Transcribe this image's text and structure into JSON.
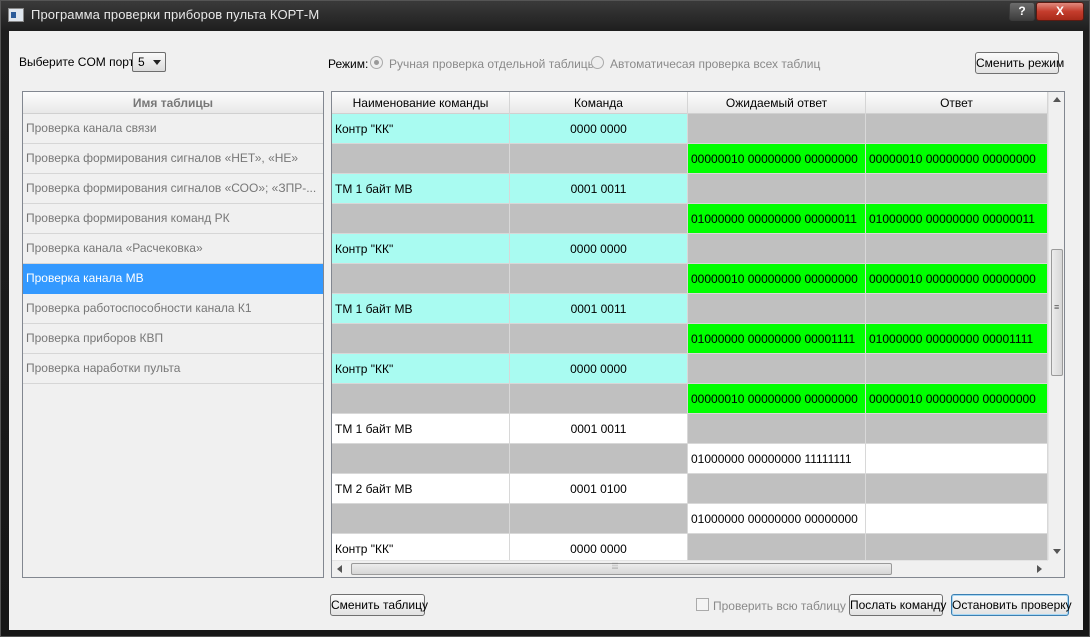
{
  "window": {
    "title": "Программа проверки приборов пульта КОРТ-М",
    "help_label": "?",
    "close_label": "X"
  },
  "colors": {
    "cyan": "#a9fbf1",
    "green": "#00ff00",
    "gray": "#c0c0c0",
    "white": "#ffffff",
    "selected": "#3399ff"
  },
  "com": {
    "label": "Выберите COM порт:",
    "value": "5"
  },
  "mode": {
    "label": "Режим:",
    "option_manual": "Ручная проверка отдельной таблицы",
    "option_auto": "Автоматичесая проверка всех таблиц",
    "selected": "manual",
    "change_button": "Сменить режим"
  },
  "tables": {
    "header": "Имя таблицы",
    "items": [
      "Проверка канала связи",
      "Проверка формирования сигналов «НЕТ», «НЕ»",
      "Проверка формирования сигналов «СОО»; «ЗПР-...",
      "Проверка формирования команд РК",
      "Проверка канала «Расчековка»",
      "Проверка канала МВ",
      "Проверка работоспособности канала К1",
      "Проверка приборов КВП",
      "Проверка наработки пульта"
    ],
    "selected_index": 5
  },
  "grid": {
    "columns": [
      "Наименование команды",
      "Команда",
      "Ожидаемый ответ",
      "Ответ"
    ],
    "rows": [
      {
        "cells": [
          "Контр \"КК\"",
          "0000 0000",
          "",
          ""
        ],
        "colors": [
          "cyan",
          "cyan",
          "gray",
          "gray"
        ]
      },
      {
        "cells": [
          "",
          "",
          "00000010  00000000  00000000",
          "00000010  00000000  00000000"
        ],
        "colors": [
          "gray",
          "gray",
          "green",
          "green"
        ]
      },
      {
        "cells": [
          "ТМ 1 байт МВ",
          "0001 0011",
          "",
          ""
        ],
        "colors": [
          "cyan",
          "cyan",
          "gray",
          "gray"
        ]
      },
      {
        "cells": [
          "",
          "",
          "01000000  00000000  00000011",
          "01000000  00000000  00000011"
        ],
        "colors": [
          "gray",
          "gray",
          "green",
          "green"
        ]
      },
      {
        "cells": [
          "Контр \"КК\"",
          "0000 0000",
          "",
          ""
        ],
        "colors": [
          "cyan",
          "cyan",
          "gray",
          "gray"
        ]
      },
      {
        "cells": [
          "",
          "",
          "00000010  00000000  00000000",
          "00000010  00000000  00000000"
        ],
        "colors": [
          "gray",
          "gray",
          "green",
          "green"
        ]
      },
      {
        "cells": [
          "ТМ 1 байт МВ",
          "0001 0011",
          "",
          ""
        ],
        "colors": [
          "cyan",
          "cyan",
          "gray",
          "gray"
        ]
      },
      {
        "cells": [
          "",
          "",
          "01000000  00000000  00001111",
          "01000000  00000000  00001111"
        ],
        "colors": [
          "gray",
          "gray",
          "green",
          "green"
        ]
      },
      {
        "cells": [
          "Контр \"КК\"",
          "0000 0000",
          "",
          ""
        ],
        "colors": [
          "cyan",
          "cyan",
          "gray",
          "gray"
        ]
      },
      {
        "cells": [
          "",
          "",
          "00000010  00000000  00000000",
          "00000010  00000000  00000000"
        ],
        "colors": [
          "gray",
          "gray",
          "green",
          "green"
        ]
      },
      {
        "cells": [
          "ТМ 1 байт МВ",
          "0001 0011",
          "",
          ""
        ],
        "colors": [
          "white",
          "white",
          "gray",
          "gray"
        ]
      },
      {
        "cells": [
          "",
          "",
          "01000000  00000000  11111111",
          ""
        ],
        "colors": [
          "gray",
          "gray",
          "white",
          "white"
        ]
      },
      {
        "cells": [
          "ТМ 2 байт МВ",
          "0001 0100",
          "",
          ""
        ],
        "colors": [
          "white",
          "white",
          "gray",
          "gray"
        ]
      },
      {
        "cells": [
          "",
          "",
          "01000000  00000000  00000000",
          ""
        ],
        "colors": [
          "gray",
          "gray",
          "white",
          "white"
        ]
      },
      {
        "cells": [
          "Контр \"КК\"",
          "0000 0000",
          "",
          ""
        ],
        "colors": [
          "white",
          "white",
          "gray",
          "gray"
        ]
      }
    ]
  },
  "bottom": {
    "change_table_button": "Сменить таблицу",
    "check_all_label": "Проверить всю таблицу",
    "check_all_checked": false,
    "send_button": "Послать команду",
    "stop_button": "Остановить проверку"
  }
}
